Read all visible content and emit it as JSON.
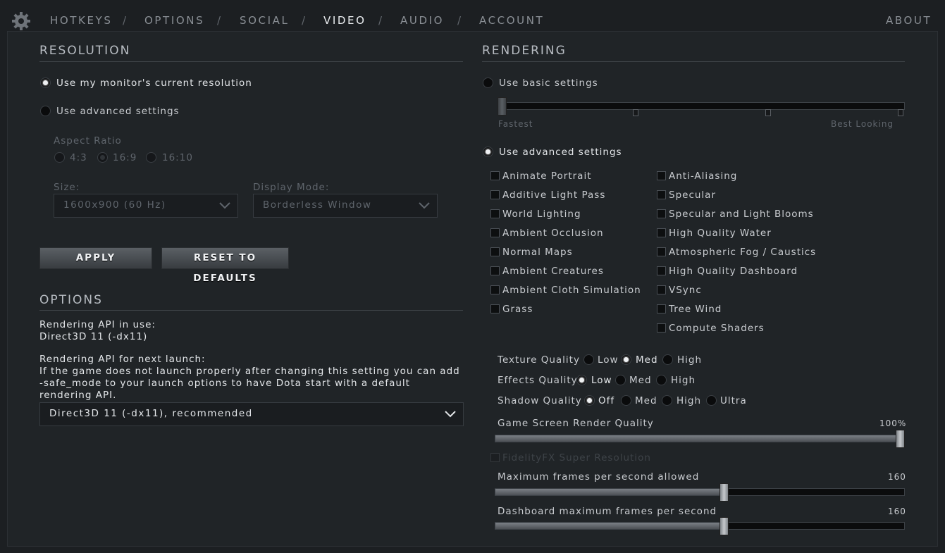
{
  "nav": {
    "tabs": [
      "HOTKEYS",
      "OPTIONS",
      "SOCIAL",
      "VIDEO",
      "AUDIO",
      "ACCOUNT"
    ],
    "separator": "/",
    "active": "VIDEO",
    "about": "ABOUT"
  },
  "resolution": {
    "title": "RESOLUTION",
    "use_monitor": "Use my monitor's current resolution",
    "use_advanced": "Use advanced settings",
    "aspect_label": "Aspect Ratio",
    "aspect_options": [
      "4:3",
      "16:9",
      "16:10"
    ],
    "aspect_selected": "16:9",
    "size_label": "Size:",
    "size_value": "1600x900 (60 Hz)",
    "display_label": "Display Mode:",
    "display_value": "Borderless Window",
    "apply": "APPLY",
    "reset": "RESET TO DEFAULTS"
  },
  "options": {
    "title": "OPTIONS",
    "api_in_use_label": "Rendering API in use:",
    "api_in_use_value": "Direct3D 11 (-dx11)",
    "api_next_label": "Rendering API for next launch:",
    "api_note": "If the game does not launch properly after changing this setting you can add -safe_mode to your launch options to have Dota start with a default rendering API.",
    "api_dropdown_value": "Direct3D 11 (-dx11), recommended"
  },
  "rendering": {
    "title": "RENDERING",
    "use_basic": "Use basic settings",
    "basic_low": "Fastest",
    "basic_high": "Best Looking",
    "basic_level": 0,
    "use_advanced": "Use advanced settings",
    "checks_left": [
      "Animate Portrait",
      "Additive Light Pass",
      "World Lighting",
      "Ambient Occlusion",
      "Normal Maps",
      "Ambient Creatures",
      "Ambient Cloth Simulation",
      "Grass"
    ],
    "checks_right": [
      "Anti-Aliasing",
      "Specular",
      "Specular and Light Blooms",
      "High Quality Water",
      "Atmospheric Fog / Caustics",
      "High Quality Dashboard",
      "VSync",
      "Tree Wind",
      "Compute Shaders"
    ],
    "texture": {
      "label": "Texture Quality",
      "options": [
        "Low",
        "Med",
        "High"
      ],
      "selected": "Med"
    },
    "effects": {
      "label": "Effects Quality",
      "options": [
        "Low",
        "Med",
        "High"
      ],
      "selected": "Low"
    },
    "shadow": {
      "label": "Shadow Quality",
      "options": [
        "Off",
        "Med",
        "High",
        "Ultra"
      ],
      "selected": "Off"
    },
    "render_quality": {
      "label": "Game Screen Render Quality",
      "value_text": "100%",
      "fraction": 1.0
    },
    "fsr": "FidelityFX Super Resolution",
    "max_fps": {
      "label": "Maximum frames per second allowed",
      "value_text": "160",
      "fraction": 0.56
    },
    "dash_fps": {
      "label": "Dashboard maximum frames per second",
      "value_text": "160",
      "fraction": 0.56
    }
  },
  "colors": {
    "background": "#202427",
    "accent": "#e9ecef"
  }
}
